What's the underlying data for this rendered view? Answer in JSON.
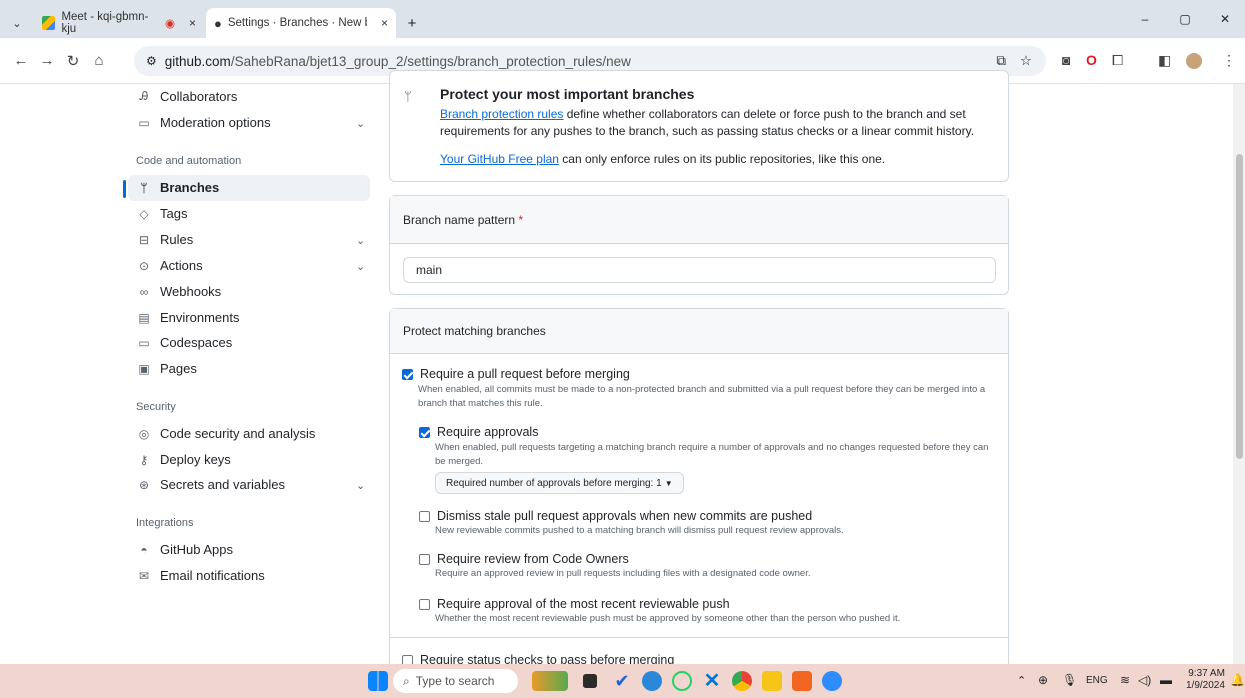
{
  "browser": {
    "tabs": [
      {
        "title": "Meet - kqi-gbmn-kju",
        "close": "×"
      },
      {
        "title": "Settings · Branches · New branc",
        "close": "×"
      }
    ],
    "new_tab": "+",
    "url_domain": "github.com",
    "url_path": "/SahebRana/bjet13_group_2/settings/branch_protection_rules/new",
    "window_controls": {
      "minimize": "–",
      "restore": "▢",
      "close": "✕"
    }
  },
  "sidebar": {
    "items_top": [
      {
        "label": "Collaborators",
        "icon": "people-icon"
      },
      {
        "label": "Moderation options",
        "icon": "comment-icon"
      }
    ],
    "sections": [
      {
        "heading": "Code and automation"
      },
      {
        "heading": "Security"
      },
      {
        "heading": "Integrations"
      }
    ],
    "code_items": [
      "Branches",
      "Tags",
      "Rules",
      "Actions",
      "Webhooks",
      "Environments",
      "Codespaces",
      "Pages"
    ],
    "security_items": [
      "Code security and analysis",
      "Deploy keys",
      "Secrets and variables"
    ],
    "integration_items": [
      "GitHub Apps",
      "Email notifications"
    ],
    "active": "Branches"
  },
  "intro": {
    "title": "Protect your most important branches",
    "link1": "Branch protection rules",
    "text1": " define whether collaborators can delete or force push to the branch and set requirements for any pushes to the branch, such as passing status checks or a linear commit history.",
    "link2": "Your GitHub Free plan",
    "text2": " can only enforce rules on its public repositories, like this one."
  },
  "pattern": {
    "label": "Branch name pattern",
    "required_mark": "*",
    "value": "main"
  },
  "protect": {
    "heading": "Protect matching branches",
    "require_pr": {
      "checked": true,
      "title": "Require a pull request before merging",
      "desc": "When enabled, all commits must be made to a non-protected branch and submitted via a pull request before they can be merged into a branch that matches this rule."
    },
    "require_approvals": {
      "checked": true,
      "title": "Require approvals",
      "desc": "When enabled, pull requests targeting a matching branch require a number of approvals and no changes requested before they can be merged.",
      "dropdown": "Required number of approvals before merging: 1"
    },
    "dismiss_stale": {
      "checked": false,
      "title": "Dismiss stale pull request approvals when new commits are pushed",
      "desc": "New reviewable commits pushed to a matching branch will dismiss pull request review approvals."
    },
    "code_owners": {
      "checked": false,
      "title": "Require review from Code Owners",
      "desc": "Require an approved review in pull requests including files with a designated code owner."
    },
    "recent_push": {
      "checked": false,
      "title": "Require approval of the most recent reviewable push",
      "desc": "Whether the most recent reviewable push must be approved by someone other than the person who pushed it."
    },
    "status_checks": {
      "checked": false,
      "title": "Require status checks to pass before merging"
    }
  },
  "taskbar": {
    "search_placeholder": "Type to search",
    "lang": "ENG",
    "time": "9:37 AM",
    "date": "1/9/2024"
  }
}
